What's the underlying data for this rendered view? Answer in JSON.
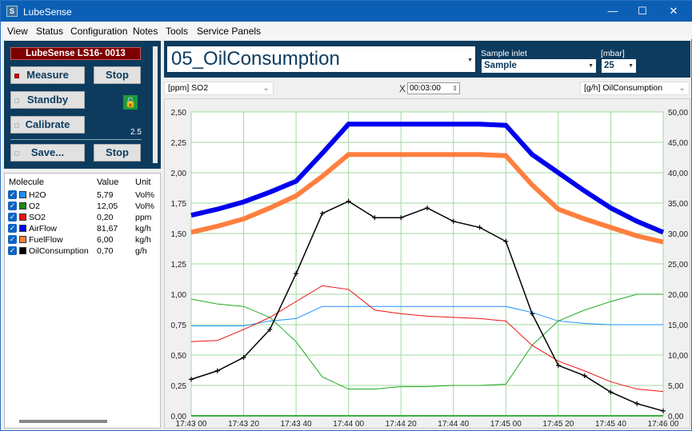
{
  "app": {
    "title": "LubeSense",
    "icon_letter": "S"
  },
  "window_controls": [
    "minimize-icon",
    "maximize-icon",
    "close-icon"
  ],
  "menu": [
    "View",
    "Status",
    "Configuration",
    "Notes",
    "Tools",
    "Service Panels"
  ],
  "control_panel": {
    "device": "LubeSense LS16- 0013",
    "measure": "Measure",
    "stop1": "Stop",
    "standby": "Standby",
    "calibrate": "Calibrate",
    "version": "2.5",
    "save": "Save...",
    "stop2": "Stop",
    "measure_active_color": "#cc0000",
    "lock_icon": "unlocked-padlock-icon"
  },
  "molecules": {
    "headers": [
      "Molecule",
      "Value",
      "Unit"
    ],
    "rows": [
      {
        "name": "H2O",
        "value": "5,79",
        "unit": "Vol%",
        "color": "#1e90ff",
        "checked": true
      },
      {
        "name": "O2",
        "value": "12,05",
        "unit": "Vol%",
        "color": "#178a17",
        "checked": true
      },
      {
        "name": "SO2",
        "value": "0,20",
        "unit": "ppm",
        "color": "#ee1111",
        "checked": true
      },
      {
        "name": "AirFlow",
        "value": "81,67",
        "unit": "kg/h",
        "color": "#0000ee",
        "checked": true
      },
      {
        "name": "FuelFlow",
        "value": "6,00",
        "unit": "kg/h",
        "color": "#ff7f3f",
        "checked": true
      },
      {
        "name": "OilConsumption",
        "value": "0,70",
        "unit": "g/h",
        "color": "#000000",
        "checked": true
      }
    ]
  },
  "header": {
    "title": "05_OilConsumption",
    "sample_inlet_label": "Sample inlet",
    "sample_inlet": "Sample",
    "pressure_label": "[mbar]",
    "pressure": "25"
  },
  "chart_toolbar": {
    "left_axis": "[ppm] SO2",
    "x_label": "X",
    "x_span": "00:03:00",
    "right_axis": "[g/h] OilConsumption"
  },
  "chart_data": {
    "type": "line",
    "grid": true,
    "x": [
      "17:43:00",
      "17:43:10",
      "17:43:20",
      "17:43:30",
      "17:43:40",
      "17:43:50",
      "17:44:00",
      "17:44:10",
      "17:44:20",
      "17:44:30",
      "17:44:40",
      "17:44:50",
      "17:45:00",
      "17:45:10",
      "17:45:20",
      "17:45:30",
      "17:45:40",
      "17:45:50",
      "17:46:00"
    ],
    "x_ticks": [
      "17:43 00",
      "17:43 20",
      "17:43 40",
      "17:44 00",
      "17:44 20",
      "17:44 40",
      "17:45 00",
      "17:45 20",
      "17:45 40",
      "17:46 00"
    ],
    "y_left": {
      "range": [
        0,
        2.5
      ],
      "ticks": [
        "0,00",
        "0,25",
        "0,50",
        "0,75",
        "1,00",
        "1,25",
        "1,50",
        "1,75",
        "2,00",
        "2,25",
        "2,50"
      ]
    },
    "y_right": {
      "range": [
        0,
        50
      ],
      "ticks": [
        "0,00",
        "5,00",
        "10,00",
        "15,00",
        "20,00",
        "25,00",
        "30,00",
        "35,00",
        "40,00",
        "45,00",
        "50,00"
      ]
    },
    "series": [
      {
        "name": "H2O",
        "axis": "left",
        "color": "#1e90ff",
        "values": [
          0.74,
          0.74,
          0.74,
          0.78,
          0.8,
          0.9,
          0.9,
          0.9,
          0.9,
          0.9,
          0.9,
          0.9,
          0.9,
          0.85,
          0.78,
          0.76,
          0.75,
          0.75,
          0.75
        ]
      },
      {
        "name": "O2",
        "axis": "left",
        "color": "#22aa22",
        "values": [
          0.96,
          0.92,
          0.9,
          0.81,
          0.61,
          0.32,
          0.22,
          0.22,
          0.24,
          0.24,
          0.25,
          0.25,
          0.26,
          0.58,
          0.78,
          0.87,
          0.94,
          1.0,
          1.0
        ]
      },
      {
        "name": "SO2",
        "axis": "left",
        "color": "#ee1111",
        "values": [
          0.61,
          0.62,
          0.71,
          0.81,
          0.94,
          1.07,
          1.04,
          0.87,
          0.84,
          0.82,
          0.81,
          0.8,
          0.78,
          0.58,
          0.45,
          0.37,
          0.28,
          0.22,
          0.2
        ]
      },
      {
        "name": "AirFlow",
        "axis": "left",
        "color": "#0000ee",
        "values": [
          1.65,
          1.7,
          1.76,
          1.84,
          1.93,
          2.16,
          2.4,
          2.4,
          2.4,
          2.4,
          2.4,
          2.4,
          2.39,
          2.15,
          2.0,
          1.85,
          1.71,
          1.6,
          1.51
        ]
      },
      {
        "name": "FuelFlow",
        "axis": "left",
        "color": "#ff7f3f",
        "values": [
          1.51,
          1.56,
          1.62,
          1.71,
          1.81,
          1.97,
          2.15,
          2.15,
          2.15,
          2.15,
          2.15,
          2.15,
          2.14,
          1.9,
          1.7,
          1.62,
          1.55,
          1.48,
          1.43
        ]
      },
      {
        "name": "OilConsumption",
        "axis": "right",
        "color": "#000000",
        "values": [
          6.0,
          7.4,
          9.6,
          14.2,
          23.4,
          33.3,
          35.3,
          32.6,
          32.6,
          34.2,
          32.0,
          31.0,
          28.7,
          16.8,
          8.3,
          6.6,
          3.9,
          2.0,
          0.8
        ]
      }
    ]
  }
}
